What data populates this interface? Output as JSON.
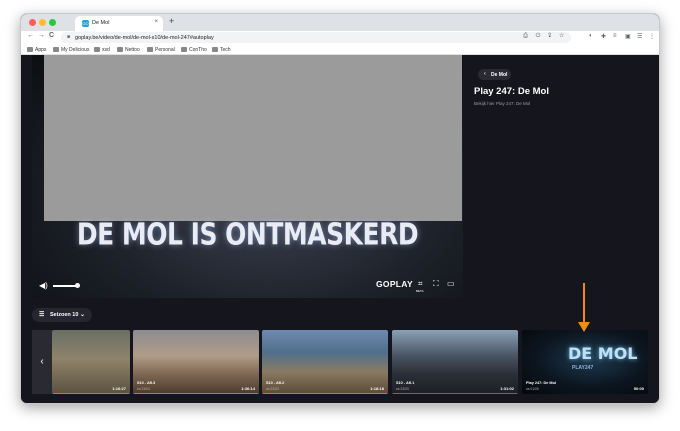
{
  "browser": {
    "tab_title": "De Mol",
    "tab_favicon": "GO",
    "tab_close": "×",
    "new_tab": "+",
    "url": "goplay.be/video/de-mol/de-mol-s10/de-mol-247#autoplay",
    "nav": {
      "back": "←",
      "forward": "→",
      "reload": "C"
    },
    "omnibox_icons": "⎙ ⏻ ⇪ ☆",
    "extensions": [
      "◐",
      "✚",
      "≡",
      "▣",
      "☰",
      "⋮"
    ],
    "bookmarks": [
      "Apps",
      "My Delicious",
      "xsd",
      "Nettoo",
      "Personal",
      "ConTho",
      "Tech"
    ]
  },
  "player": {
    "caption": "DE MOL IS ONTMASKERD",
    "brand": "GOPLAY",
    "cast_label": "BETA",
    "volume_level": 0.9,
    "icons": {
      "volume": "volume-icon",
      "cast": "cast-icon",
      "fullscreen": "fullscreen-icon",
      "theater": "theater-icon"
    }
  },
  "panel": {
    "back_label": "De Mol",
    "back_chevron": "‹",
    "title": "Play 247: De Mol",
    "subtitle": "Bekijk hier Play 247: De Mol"
  },
  "season": {
    "label": "Seizoen 10",
    "chevron": "⌄"
  },
  "carousel": {
    "prev_arrow": "‹",
    "thumbnails": [
      {
        "label": "",
        "date": "",
        "duration": "1:16:27",
        "progress": 1.0
      },
      {
        "label": "S10 - Afl.3",
        "date": "za 23/04",
        "duration": "1:36:14",
        "progress": 1.0
      },
      {
        "label": "S10 - Afl.2",
        "date": "za 23/03",
        "duration": "1:18:18",
        "progress": 1.0
      },
      {
        "label": "S10 - Afl.1",
        "date": "za 23/03",
        "duration": "1:31:02",
        "progress": 0.0
      },
      {
        "label": "Play 247: De Mol",
        "date": "za 01/05",
        "duration": "50:00",
        "progress": 0.0,
        "logo": "DE MOL",
        "logo_sub": "PLAY247"
      }
    ]
  },
  "colors": {
    "accent": "#3fa8a0",
    "annotation": "#f28a17",
    "background": "#15151d"
  }
}
